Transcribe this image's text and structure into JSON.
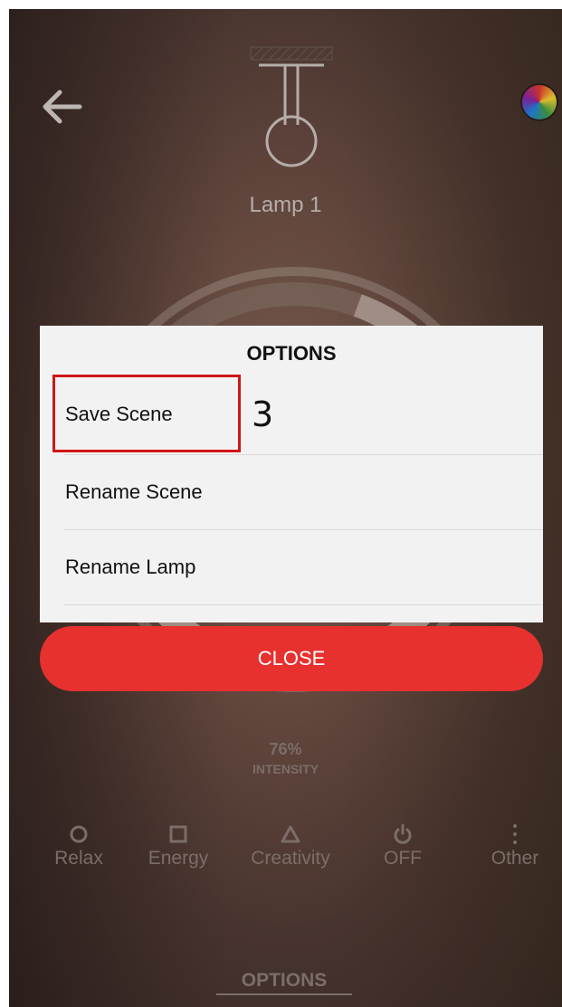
{
  "header": {
    "back_icon": "arrow-left-icon",
    "color_icon": "color-wheel-icon",
    "lamp_icon": "pendant-lamp-icon",
    "lamp_name": "Lamp 1"
  },
  "intensity": {
    "value": "76%",
    "label": "INTENSITY",
    "fraction": 0.76
  },
  "modes": [
    {
      "label": "Relax",
      "icon": "circle-icon"
    },
    {
      "label": "Energy",
      "icon": "square-icon"
    },
    {
      "label": "Creativity",
      "icon": "triangle-icon"
    },
    {
      "label": "OFF",
      "icon": "power-icon"
    },
    {
      "label": "Other",
      "icon": "more-vertical-icon"
    }
  ],
  "bottom": {
    "options_label": "OPTIONS"
  },
  "dialog": {
    "title": "OPTIONS",
    "items": [
      {
        "label": "Save Scene"
      },
      {
        "label": "Rename Scene"
      },
      {
        "label": "Rename Lamp"
      }
    ],
    "close_label": "CLOSE"
  },
  "annotation": {
    "step_number": "3"
  },
  "colors": {
    "close_button": "#e6312f",
    "dialog_background": "#f2f2f2",
    "highlight": "#d01616",
    "muted_text": "#8d7d77"
  }
}
